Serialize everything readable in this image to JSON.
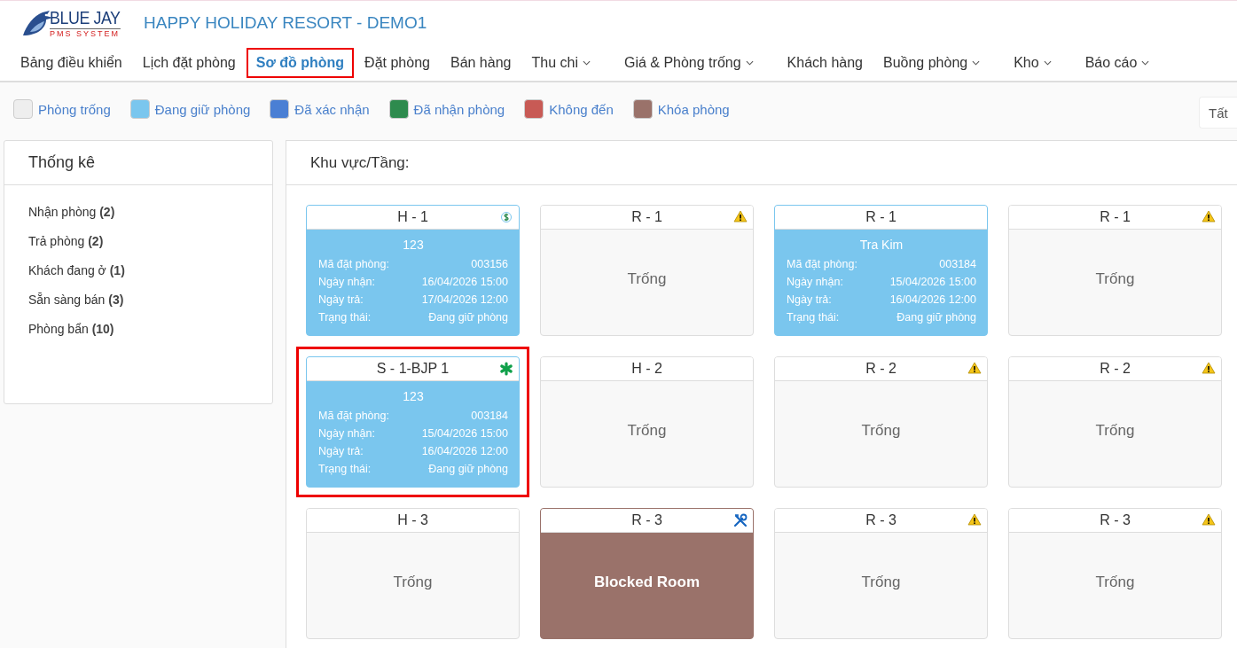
{
  "logo": {
    "name": "BLUE JAY",
    "tagline": "PMS SYSTEM"
  },
  "hotel_title": "HAPPY HOLIDAY RESORT - DEMO1",
  "nav": [
    {
      "label": "Bảng điều khiển",
      "selected": false,
      "dropdown": false
    },
    {
      "label": "Lịch đặt phòng",
      "selected": false,
      "dropdown": false
    },
    {
      "label": "Sơ đồ phòng",
      "selected": true,
      "dropdown": false
    },
    {
      "label": "Đặt phòng",
      "selected": false,
      "dropdown": false
    },
    {
      "label": "Bán hàng",
      "selected": false,
      "dropdown": false
    },
    {
      "label": "Thu chi",
      "selected": false,
      "dropdown": true
    },
    {
      "label": "Giá & Phòng trống",
      "selected": false,
      "dropdown": true
    },
    {
      "label": "Khách hàng",
      "selected": false,
      "dropdown": false
    },
    {
      "label": "Buồng phòng",
      "selected": false,
      "dropdown": true
    },
    {
      "label": "Kho",
      "selected": false,
      "dropdown": true
    },
    {
      "label": "Báo cáo",
      "selected": false,
      "dropdown": true
    }
  ],
  "legend": [
    {
      "label": "Phòng trống",
      "color": "#eeeeee"
    },
    {
      "label": "Đang giữ phòng",
      "color": "#7ac6ee"
    },
    {
      "label": "Đã xác nhận",
      "color": "#4a7fd4"
    },
    {
      "label": "Đã nhận phòng",
      "color": "#2e8b4e"
    },
    {
      "label": "Không đến",
      "color": "#c85a55"
    },
    {
      "label": "Khóa phòng",
      "color": "#9a726a"
    }
  ],
  "filter": {
    "value": "Tất"
  },
  "stats": {
    "title": "Thống kê",
    "items": [
      {
        "label": "Nhận phòng",
        "count": "(2)"
      },
      {
        "label": "Trả phòng",
        "count": "(2)"
      },
      {
        "label": "Khách đang ở",
        "count": "(1)"
      },
      {
        "label": "Sẵn sàng bán",
        "count": "(3)"
      },
      {
        "label": "Phòng bẩn",
        "count": "(10)"
      }
    ]
  },
  "area": {
    "title": "Khu vực/Tầng:"
  },
  "rooms": [
    {
      "name": "H - 1",
      "kind": "booked",
      "marker": {
        "kind": "payment"
      },
      "highlighted": false,
      "guest": "123",
      "details": [
        {
          "label": "Mã đặt phòng:",
          "value": "003156"
        },
        {
          "label": "Ngày nhận:",
          "value": "16/04/2026 15:00"
        },
        {
          "label": "Ngày trả:",
          "value": "17/04/2026 12:00"
        },
        {
          "label": "Trạng thái:",
          "value": "Đang giữ phòng"
        }
      ]
    },
    {
      "name": "R - 1",
      "kind": "empty",
      "marker": {
        "kind": "warning"
      },
      "highlighted": false,
      "status": "Trống"
    },
    {
      "name": "R - 1",
      "kind": "booked",
      "highlighted": false,
      "guest": "Tra Kim",
      "details": [
        {
          "label": "Mã đặt phòng:",
          "value": "003184"
        },
        {
          "label": "Ngày nhận:",
          "value": "15/04/2026 15:00"
        },
        {
          "label": "Ngày trả:",
          "value": "16/04/2026 12:00"
        },
        {
          "label": "Trạng thái:",
          "value": "Đang giữ phòng"
        }
      ]
    },
    {
      "name": "R - 1",
      "kind": "empty",
      "marker": {
        "kind": "warning"
      },
      "highlighted": false,
      "status": "Trống"
    },
    {
      "name": "S - 1-BJP 1",
      "kind": "booked",
      "marker": {
        "kind": "asterisk"
      },
      "highlighted": true,
      "guest": "123",
      "details": [
        {
          "label": "Mã đặt phòng:",
          "value": "003184"
        },
        {
          "label": "Ngày nhận:",
          "value": "15/04/2026 15:00"
        },
        {
          "label": "Ngày trả:",
          "value": "16/04/2026 12:00"
        },
        {
          "label": "Trạng thái:",
          "value": "Đang giữ phòng"
        }
      ]
    },
    {
      "name": "H - 2",
      "kind": "empty",
      "highlighted": false,
      "status": "Trống"
    },
    {
      "name": "R - 2",
      "kind": "empty",
      "marker": {
        "kind": "warning"
      },
      "highlighted": false,
      "status": "Trống"
    },
    {
      "name": "R - 2",
      "kind": "empty",
      "marker": {
        "kind": "warning"
      },
      "highlighted": false,
      "status": "Trống"
    },
    {
      "name": "H - 3",
      "kind": "empty",
      "highlighted": false,
      "status": "Trống"
    },
    {
      "name": "R - 3",
      "kind": "blocked",
      "marker": {
        "kind": "maintenance"
      },
      "highlighted": false,
      "status": "Blocked Room"
    },
    {
      "name": "R - 3",
      "kind": "empty",
      "marker": {
        "kind": "warning"
      },
      "highlighted": false,
      "status": "Trống"
    },
    {
      "name": "R - 3",
      "kind": "empty",
      "marker": {
        "kind": "warning"
      },
      "highlighted": false,
      "status": "Trống"
    }
  ]
}
